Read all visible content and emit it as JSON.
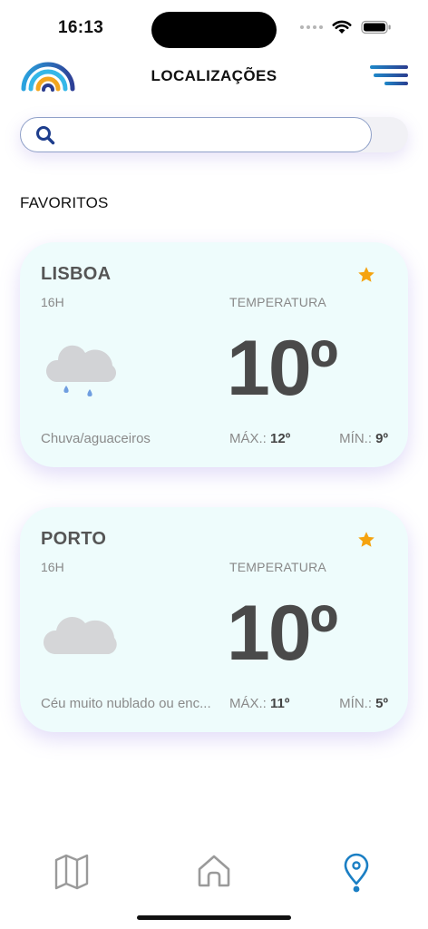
{
  "status_bar": {
    "time": "16:13"
  },
  "header": {
    "title": "LOCALIZAÇÕES",
    "logo_icon": "rainbow-logo-icon",
    "menu_icon": "hamburger-menu-icon"
  },
  "search": {
    "placeholder": "",
    "value": "",
    "icon": "search-icon"
  },
  "favorites": {
    "label": "FAVORITOS",
    "cards": [
      {
        "city": "LISBOA",
        "hour": "16H",
        "temp_label": "TEMPERATURA",
        "temp": "10º",
        "description": "Chuva/aguaceiros",
        "max_label": "MÁX.:",
        "max": "12º",
        "min_label": "MÍN.:",
        "min": "9º",
        "icon": "rain-cloud-icon",
        "favorite": true
      },
      {
        "city": "PORTO",
        "hour": "16H",
        "temp_label": "TEMPERATURA",
        "temp": "10º",
        "description": "Céu muito nublado ou enc...",
        "max_label": "MÁX.:",
        "max": "11º",
        "min_label": "MÍN.:",
        "min": "5º",
        "icon": "cloud-icon",
        "favorite": true
      }
    ]
  },
  "bottom_nav": {
    "items": [
      "map-icon",
      "home-icon",
      "location-pin-icon"
    ],
    "active": "location-pin-icon"
  },
  "colors": {
    "accent": "#1e88c9",
    "star": "#f5a30f",
    "card_bg": "#eefcfc"
  }
}
